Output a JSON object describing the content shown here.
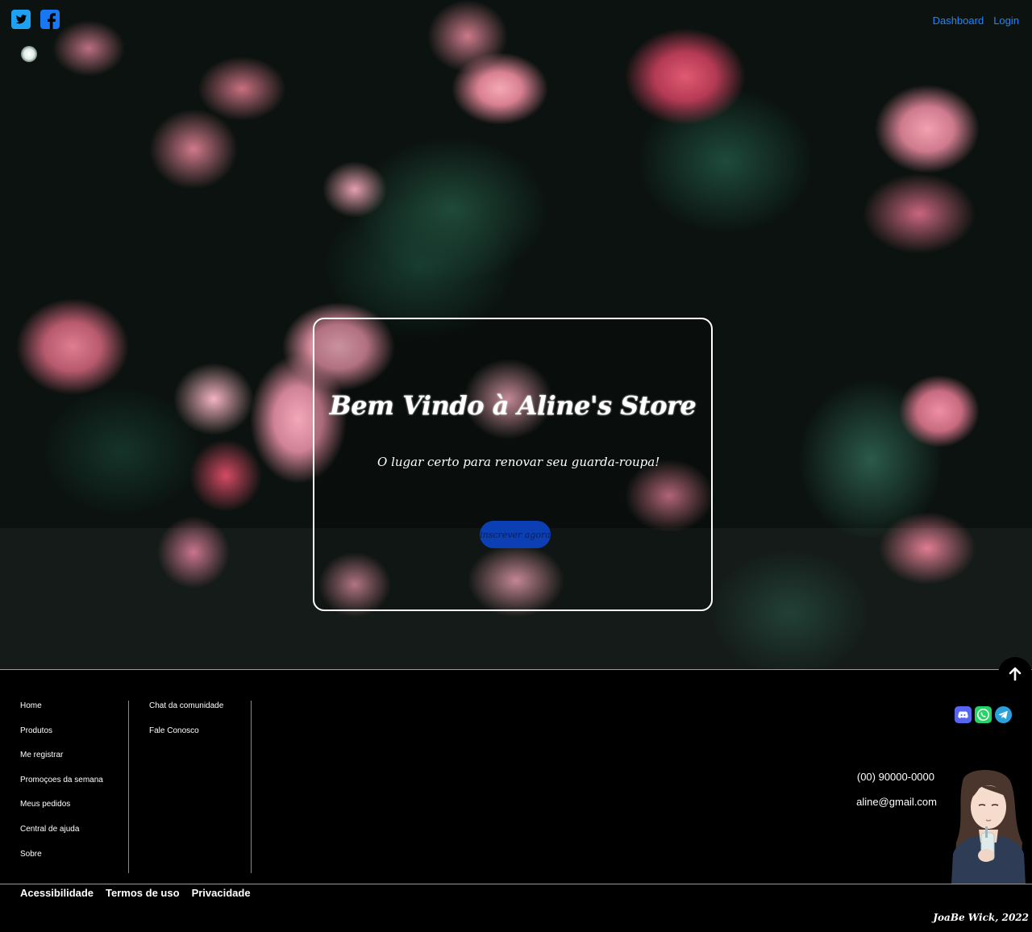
{
  "header": {
    "social": [
      {
        "name": "twitter-icon",
        "color": "#1da1f2"
      },
      {
        "name": "facebook-icon",
        "color": "#1877f2"
      }
    ],
    "nav": [
      {
        "label": "Dashboard"
      },
      {
        "label": "Login"
      }
    ],
    "nav_color": "#1e88ff"
  },
  "hero": {
    "title": "Bem Vindo à Aline's Store",
    "subtitle": "O lugar certo para renovar seu guarda-roupa!",
    "cta_label": "inscrever agora",
    "cta_color": "#0b3fb3"
  },
  "footer": {
    "scroll_top_icon": "arrow-up-icon",
    "links_col_1": [
      {
        "label": "Home"
      },
      {
        "label": "Produtos"
      },
      {
        "label": "Me registrar"
      },
      {
        "label": "Promoçoes da semana"
      },
      {
        "label": "Meus pedidos"
      },
      {
        "label": "Central de ajuda"
      },
      {
        "label": "Sobre"
      }
    ],
    "links_col_2": [
      {
        "label": "Chat da comunidade"
      },
      {
        "label": "Fale Conosco"
      }
    ],
    "social": [
      {
        "name": "discord-icon",
        "color": "#5865f2"
      },
      {
        "name": "whatsapp-icon",
        "color": "#25d366"
      },
      {
        "name": "telegram-icon",
        "color": "#2aa1da"
      }
    ],
    "contact": {
      "phone": "(00) 90000-0000",
      "email": "aline@gmail.com"
    },
    "legal": [
      {
        "label": "Acessibilidade"
      },
      {
        "label": "Termos de uso"
      },
      {
        "label": "Privacidade"
      }
    ],
    "signature": "JoaBe Wick, 2022"
  }
}
